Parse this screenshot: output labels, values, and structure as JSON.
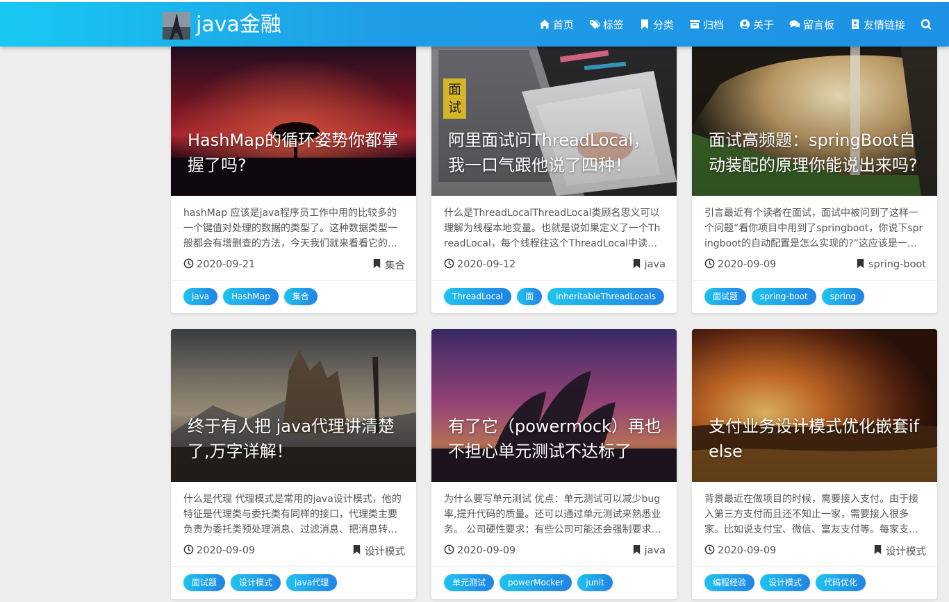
{
  "site": {
    "brand": "java金融",
    "logo_icon": "eiffel-tower-logo"
  },
  "nav": {
    "items": [
      {
        "label": "首页",
        "icon": "home-icon"
      },
      {
        "label": "标签",
        "icon": "tags-icon"
      },
      {
        "label": "分类",
        "icon": "bookmark-icon"
      },
      {
        "label": "归档",
        "icon": "archive-icon"
      },
      {
        "label": "关于",
        "icon": "user-circle-icon"
      },
      {
        "label": "留言板",
        "icon": "comments-icon"
      },
      {
        "label": "友情链接",
        "icon": "address-book-icon"
      }
    ],
    "search_icon": "search-icon"
  },
  "colors": {
    "nav_start": "#17c9f2",
    "nav_end": "#1e91e4",
    "tag_start": "#1fc3ee",
    "tag_end": "#2183e3",
    "sticky_badge": "#d4b52a"
  },
  "posts": [
    {
      "title": "HashMap的循环姿势你都掌握了吗?",
      "summary": "hashMap 应该是java程序员工作中用的比较多的一个键值对处理的数据的类型了。这种数据类型一般都会有增删查的方法，今天我们就来看看它的循环方法",
      "date": "2020-09-21",
      "category": "集合",
      "tags": [
        "java",
        "HashMap",
        "集合"
      ],
      "sticky": ""
    },
    {
      "title": "阿里面试问ThreadLocal，我一口气跟他说了四种！",
      "summary": "什么是ThreadLocalThreadLocal类顾名思义可以理解为线程本地变量。也就是说如果定义了一个ThreadLocal，每个线程往这个ThreadLocal中读写是线程隔离的",
      "date": "2020-09-12",
      "category": "java",
      "tags": [
        "ThreadLocal",
        "面试",
        "inheritableThreadLocals"
      ],
      "sticky": "面试"
    },
    {
      "title": "面试高频题：springBoot自动装配的原理你能说出来吗?",
      "summary": "引言最近有个读者在面试，面试中被问到了这样一个问题“看你项目中用到了springboot，你说下springboot的自动配置是怎么实现的?”这应该是一个springboot里面最基础的问题",
      "date": "2020-09-09",
      "category": "spring-boot",
      "tags": [
        "面试题",
        "spring-boot",
        "spring"
      ],
      "sticky": ""
    },
    {
      "title": "终于有人把 java代理讲清楚了,万字详解！",
      "summary": "什么是代理 代理模式是常用的java设计模式，他的特征是代理类与委托类有同样的接口，代理类主要负责为委托类预处理消息、过滤消息、把消息转发给委托类",
      "date": "2020-09-09",
      "category": "设计模式",
      "tags": [
        "面试题",
        "设计模式",
        "java代理"
      ],
      "sticky": ""
    },
    {
      "title": "有了它（powermock）再也不担心单元测试不达标了",
      "summary": "为什么要写单元测试 优点：单元测试可以减少bug率,提升代码的质量。还可以通过单元测试来熟悉业务。 公司硬性要求：有些公司可能还会强制要求单元测试覆盖率",
      "date": "2020-09-09",
      "category": "java",
      "tags": [
        "单元测试",
        "powerMocker",
        "junit"
      ],
      "sticky": ""
    },
    {
      "title": "支付业务设计模式优化嵌套if else",
      "summary": "背景最近在做项目的时候，需要接入支付。由于接入第三方支付而且还不知止一家，需要接入很多家。比如说支付宝、微信、富友支付等。每家支付都一个回调",
      "date": "2020-09-09",
      "category": "设计模式",
      "tags": [
        "编程经验",
        "设计模式",
        "代码优化"
      ],
      "sticky": ""
    }
  ]
}
